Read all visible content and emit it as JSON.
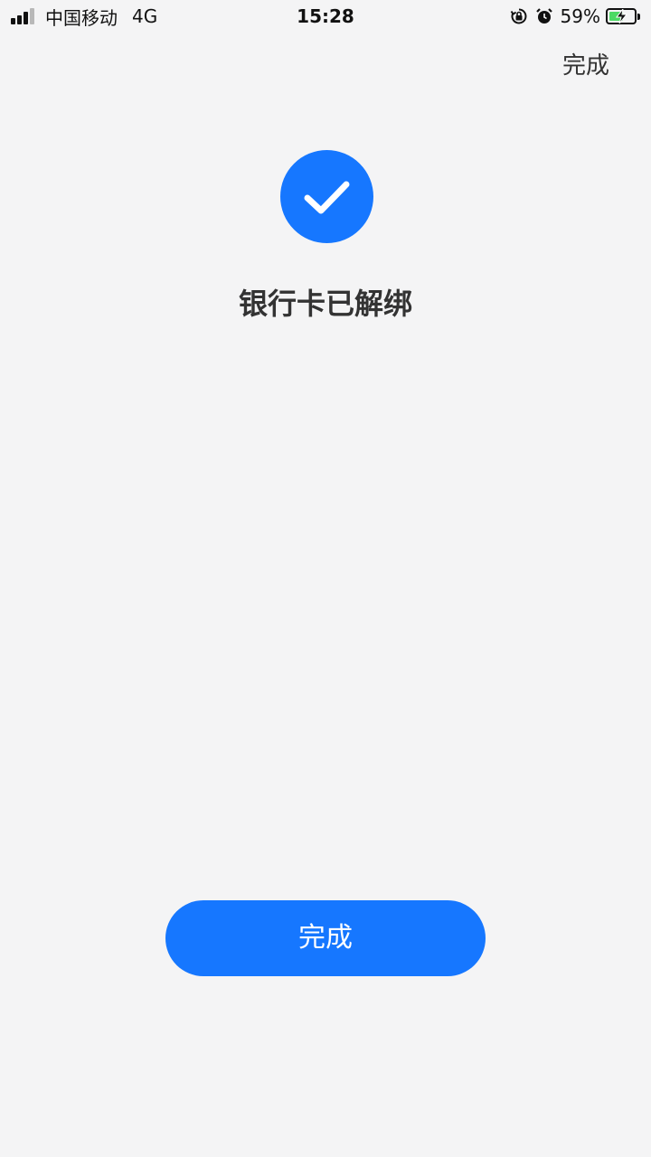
{
  "status_bar": {
    "carrier": "中国移动",
    "network": "4G",
    "time": "15:28",
    "battery_percent": "59%",
    "battery_level": 0.59,
    "icons": [
      "signal-icon",
      "rotation-lock-icon",
      "alarm-icon",
      "battery-charging-icon"
    ]
  },
  "nav": {
    "done_label": "完成"
  },
  "result": {
    "icon": "check-icon",
    "title": "银行卡已解绑"
  },
  "footer": {
    "done_button_label": "完成"
  },
  "colors": {
    "accent": "#1677ff",
    "background": "#f4f4f5",
    "text": "#333333",
    "battery_fill": "#4cd964"
  }
}
